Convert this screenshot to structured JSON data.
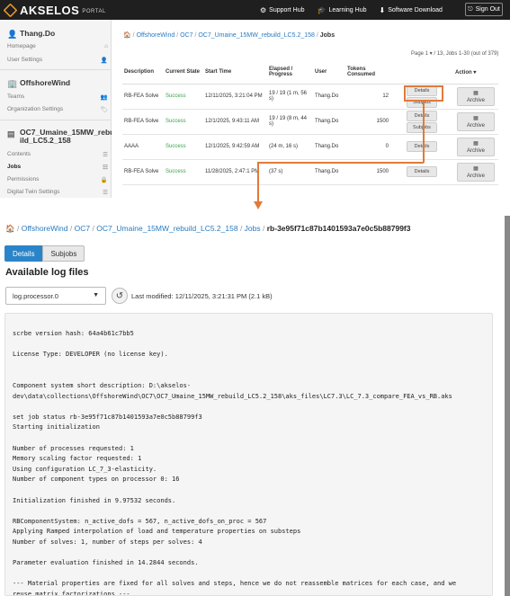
{
  "header": {
    "logo_text": "AKSELOS",
    "logo_sub": "PORTAL",
    "links": [
      {
        "icon": "gear-icon",
        "glyph": "⚙",
        "label": "Support Hub"
      },
      {
        "icon": "graduation-cap-icon",
        "glyph": "🎓",
        "label": "Learning Hub"
      },
      {
        "icon": "download-icon",
        "glyph": "⬇",
        "label": "Software Download"
      }
    ],
    "signout_label": "Sign Out"
  },
  "sidebar": {
    "user": {
      "name": "Thang.Do",
      "items": [
        "Homepage",
        "User Settings"
      ]
    },
    "org": {
      "name": "OffshoreWind",
      "items": [
        "Teams",
        "Organization Settings"
      ]
    },
    "collection": {
      "name_line1": "OC7_Umaine_15MW_rebu",
      "name_line2": "ild_LC5.2_158",
      "items": [
        "Contents",
        "Jobs",
        "Permissions",
        "Digital Twin Settings"
      ]
    }
  },
  "jobs_page": {
    "breadcrumb": [
      "OffshoreWind",
      "OC7",
      "OC7_Umaine_15MW_rebuild_LC5.2_158",
      "Jobs"
    ],
    "page_info": "Page 1 ▾ / 13, Jobs 1-30 (out of 379)",
    "columns": [
      "Description",
      "Current State",
      "Start Time",
      "Elapsed / Progress",
      "User",
      "Tokens Consumed",
      "",
      "Action ▾"
    ],
    "rows": [
      {
        "desc": "RB-FEA Solve",
        "state": "Success",
        "start": "12/11/2025, 3:21:04 PM",
        "elapsed": "19 / 19 (1 m, 56 s)",
        "user": "Thang.Do",
        "tokens": "12",
        "details": "Details",
        "subjobs": "Subjobs",
        "archive": "Archive"
      },
      {
        "desc": "RB-FEA Solve",
        "state": "Success",
        "start": "12/1/2025, 9:43:11 AM",
        "elapsed": "19 / 19 (8 m, 44 s)",
        "user": "Thang.Do",
        "tokens": "1500",
        "details": "Details",
        "subjobs": "Subjobs",
        "archive": "Archive"
      },
      {
        "desc": "AAAA",
        "state": "Success",
        "start": "12/1/2025, 9:42:59 AM",
        "elapsed": "(24 m, 16 s)",
        "user": "Thang.Do",
        "tokens": "0",
        "details": "Details",
        "subjobs": "",
        "archive": "Archive"
      },
      {
        "desc": "RB-FEA Solve",
        "state": "Success",
        "start": "11/28/2025, 2:47:1 PM",
        "elapsed": "(37 s)",
        "user": "Thang.Do",
        "tokens": "1500",
        "details": "Details",
        "subjobs": "",
        "archive": "Archive"
      }
    ]
  },
  "detail_page": {
    "breadcrumb": [
      "OffshoreWind",
      "OC7",
      "OC7_Umaine_15MW_rebuild_LC5.2_158",
      "Jobs"
    ],
    "job_id": "rb-3e95f71c87b1401593a7e0c5b88799f3",
    "tabs": [
      "Details",
      "Subjobs"
    ],
    "available_title": "Available log files",
    "log_select": "log.processor.0",
    "last_modified": "Last modified: 12/11/2025, 3:21:31 PM (2.1 kB)",
    "log_lines": [
      "scrbe version hash: 64a4b61c7bb5",
      "",
      "License Type: DEVELOPER (no license key).",
      "",
      "",
      "Component system short description: D:\\akselos-",
      "dev\\data\\collections\\OffshoreWind\\OC7\\OC7_Umaine_15MW_rebuild_LC5.2_158\\aks_files\\LC7.3\\LC_7.3_compare_FEA_vs_RB.aks",
      "",
      "set job status rb-3e95f71c87b1401593a7e0c5b88799f3",
      "Starting initialization",
      "",
      "Number of processes requested: 1",
      "Memory scaling factor requested: 1",
      "Using configuration LC_7_3-elasticity.",
      "Number of component types on processor 0: 16",
      "",
      "Initialization finished in 9.97532 seconds.",
      "",
      "RBComponentSystem: n_active_dofs = 567, n_active_dofs_on_proc = 567",
      "Applying Ramped interpolation of load and temperature properties on substeps",
      "Number of solves: 1, number of steps per solves: 4",
      "",
      "Parameter evaluation finished in 14.2844 seconds.",
      "",
      "--- Material properties are fixed for all solves and steps, hence we do not reassemble matrices for each case, and we",
      "reuse matrix factorizations ---"
    ]
  }
}
